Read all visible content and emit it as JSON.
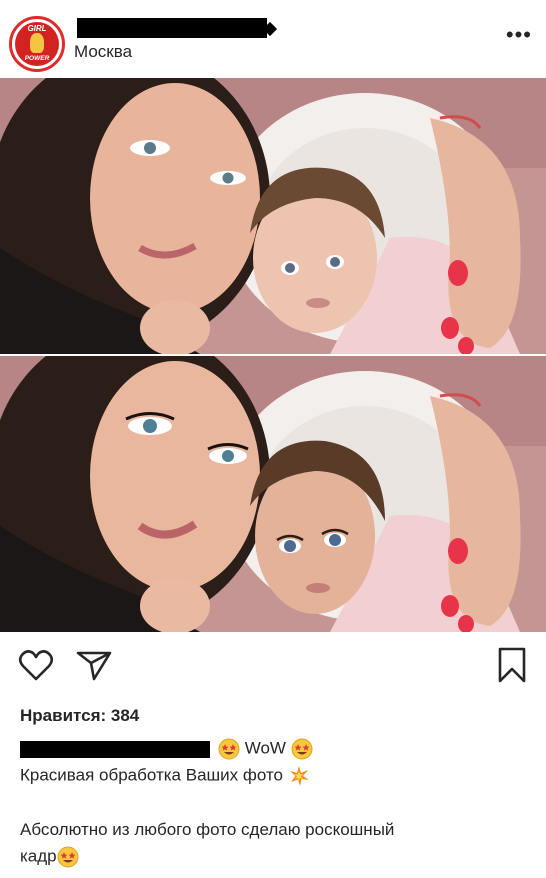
{
  "header": {
    "avatar": {
      "top_text": "GIRL",
      "bottom_text": "POWER"
    },
    "location": "Москва",
    "more_icon": "more-horizontal-icon"
  },
  "photos": [
    {
      "description_tag": "mother-and-baby-photo-original"
    },
    {
      "description_tag": "mother-and-baby-photo-edited"
    }
  ],
  "actions": {
    "like_icon": "heart-icon",
    "share_icon": "paper-plane-icon",
    "save_icon": "bookmark-icon"
  },
  "likes": {
    "text": "Нравится: 384"
  },
  "caption": {
    "wow_text": "WoW",
    "line2": "Красивая обработка Ваших фото",
    "line3": "Абсолютно из любого фото сделаю роскошный",
    "line4": "кадр"
  },
  "colors": {
    "avatar_red": "#d32222",
    "text": "#262626",
    "nails": "#e8344a"
  }
}
